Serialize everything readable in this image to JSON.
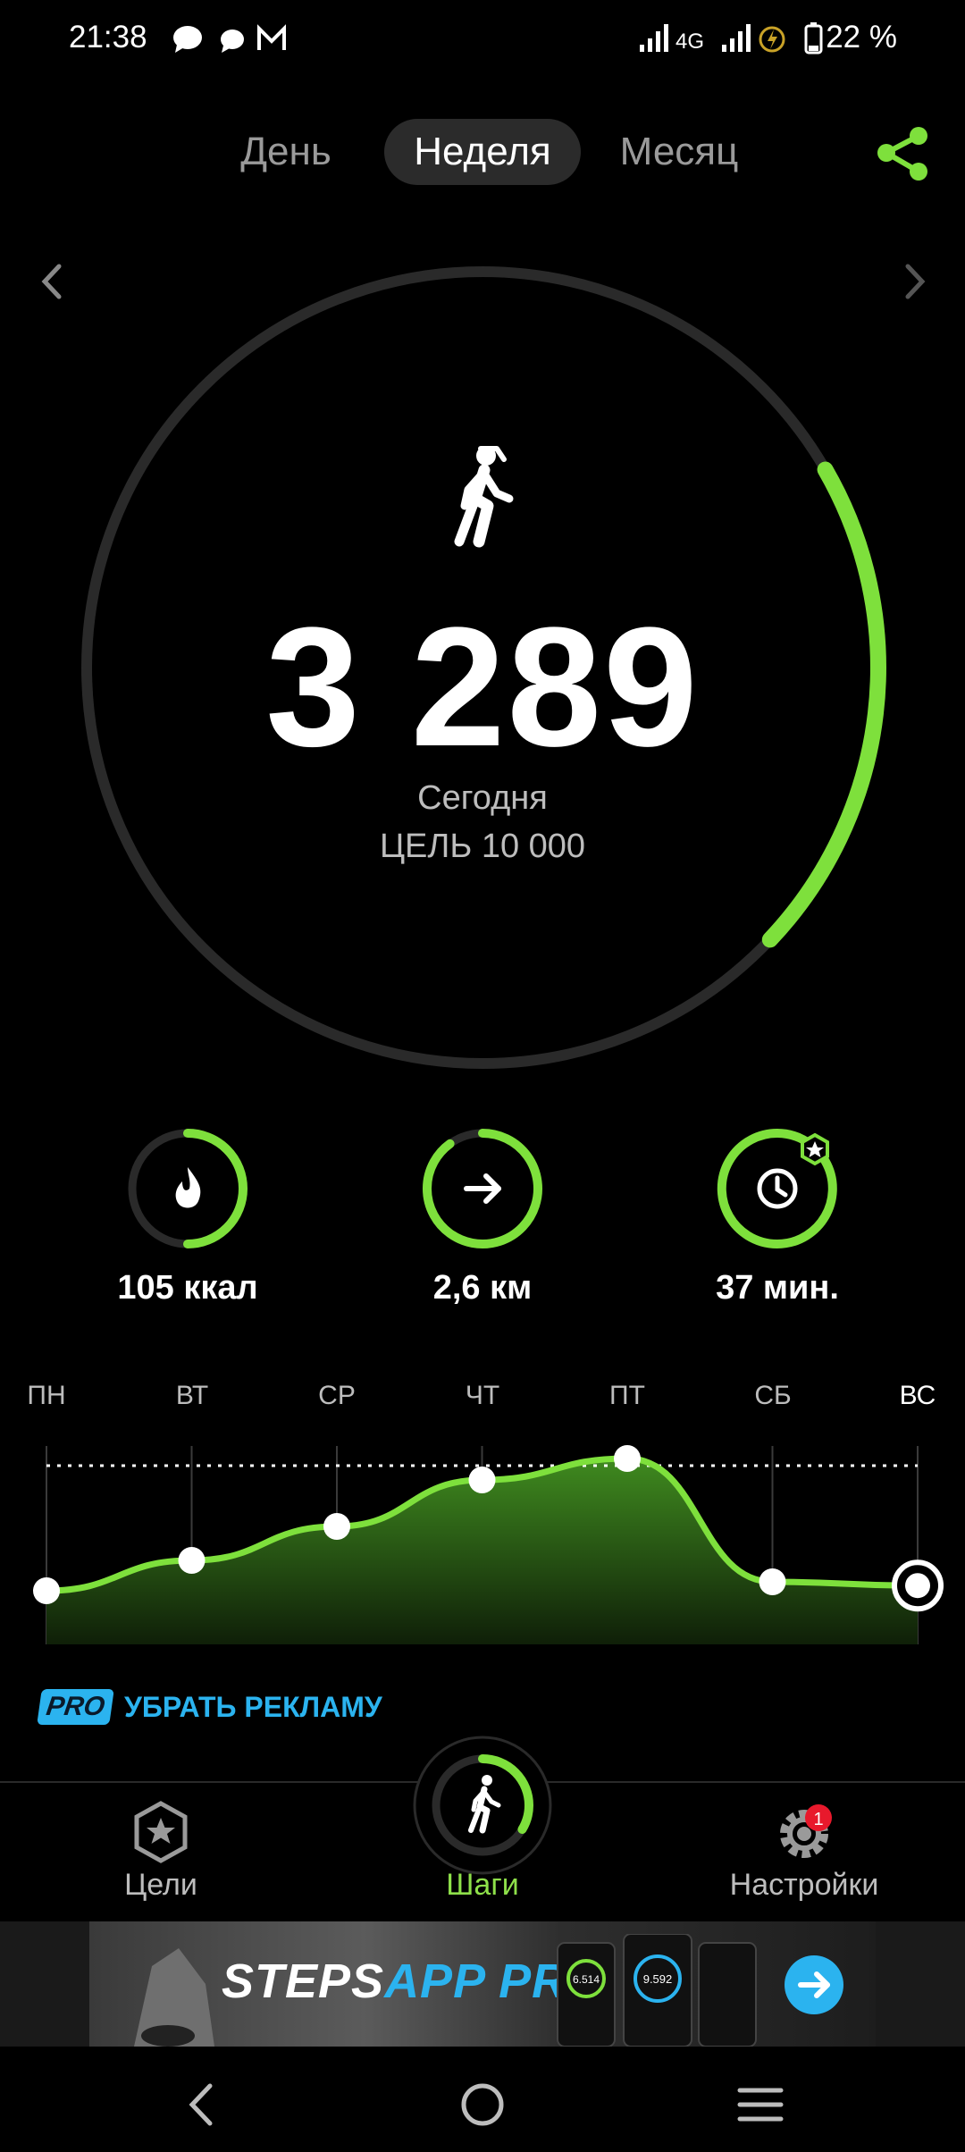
{
  "status_bar": {
    "time": "21:38",
    "network": "4G",
    "battery_percent": "22 %"
  },
  "tabs": [
    {
      "label": "День",
      "active": false
    },
    {
      "label": "Неделя",
      "active": true
    },
    {
      "label": "Месяц",
      "active": false
    }
  ],
  "icons": {
    "share": "share-icon",
    "prev": "chevron-left-icon",
    "next": "chevron-right-icon",
    "walker": "walking-person-icon"
  },
  "colors": {
    "accent": "#7ee03c",
    "pro": "#2bb3ef",
    "badge": "#e8192c"
  },
  "steps": {
    "value": "3 289",
    "period": "Сегодня",
    "goal": "ЦЕЛЬ 10 000",
    "progress": 0.3289
  },
  "metrics": [
    {
      "icon": "flame-icon",
      "label": "105 ккал",
      "progress": 0.5
    },
    {
      "icon": "arrow-right-icon",
      "label": "2,6 км",
      "progress": 0.9
    },
    {
      "icon": "clock-icon",
      "label": "37 мин.",
      "progress": 1.0
    }
  ],
  "chart_data": {
    "type": "area",
    "categories": [
      "ПН",
      "ВТ",
      "СР",
      "ЧТ",
      "ПТ",
      "СБ",
      "ВС"
    ],
    "values": [
      3000,
      4700,
      6600,
      9200,
      10400,
      3500,
      3289
    ],
    "goal": 10000,
    "ylim": [
      0,
      12000
    ],
    "selected": "ВС"
  },
  "promo": {
    "badge": "PRO",
    "text": "УБРАТЬ РЕКЛАМУ"
  },
  "bottom_nav": [
    {
      "label": "Цели",
      "icon": "star-badge-icon",
      "active": false
    },
    {
      "label": "Шаги",
      "icon": "walking-person-icon",
      "active": true
    },
    {
      "label": "Настройки",
      "icon": "gear-icon",
      "active": false,
      "badge": "1"
    }
  ],
  "ad": {
    "title_a": "STEPS",
    "title_b": "APP PRO",
    "phone_value_1": "6.514",
    "phone_value_2": "9.592"
  }
}
